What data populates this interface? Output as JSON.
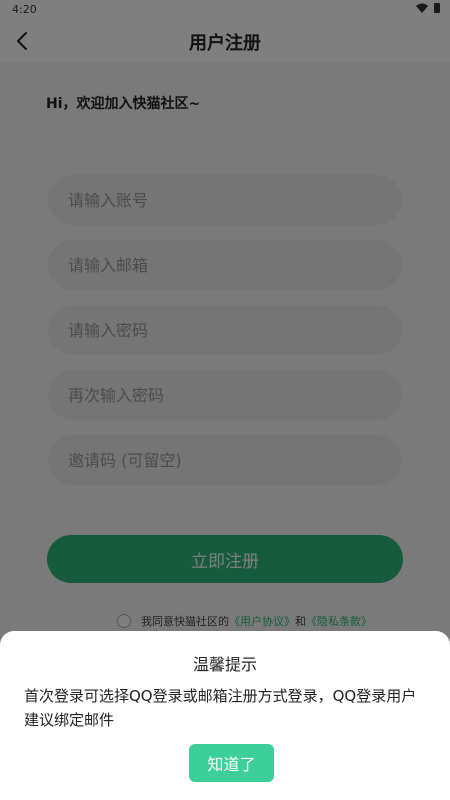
{
  "status_bar": {
    "time": "4:20"
  },
  "header": {
    "title": "用户注册"
  },
  "greeting": "Hi，欢迎加入快猫社区~",
  "form": {
    "account_placeholder": "请输入账号",
    "email_placeholder": "请输入邮箱",
    "password_placeholder": "请输入密码",
    "password_confirm_placeholder": "再次输入密码",
    "invite_placeholder": "邀请码 (可留空)",
    "register_label": "立即注册"
  },
  "agreement": {
    "prefix": "我同意快猫社区的",
    "user_agreement": "《用户协议》",
    "and": "和",
    "privacy": "《隐私条款》"
  },
  "dialog": {
    "title": "温馨提示",
    "body": "首次登录可选择QQ登录或邮箱注册方式登录，QQ登录用户建议绑定邮件",
    "ok_label": "知道了"
  },
  "colors": {
    "accent": "#2db77b",
    "dialog_button": "#3ccf9a"
  }
}
